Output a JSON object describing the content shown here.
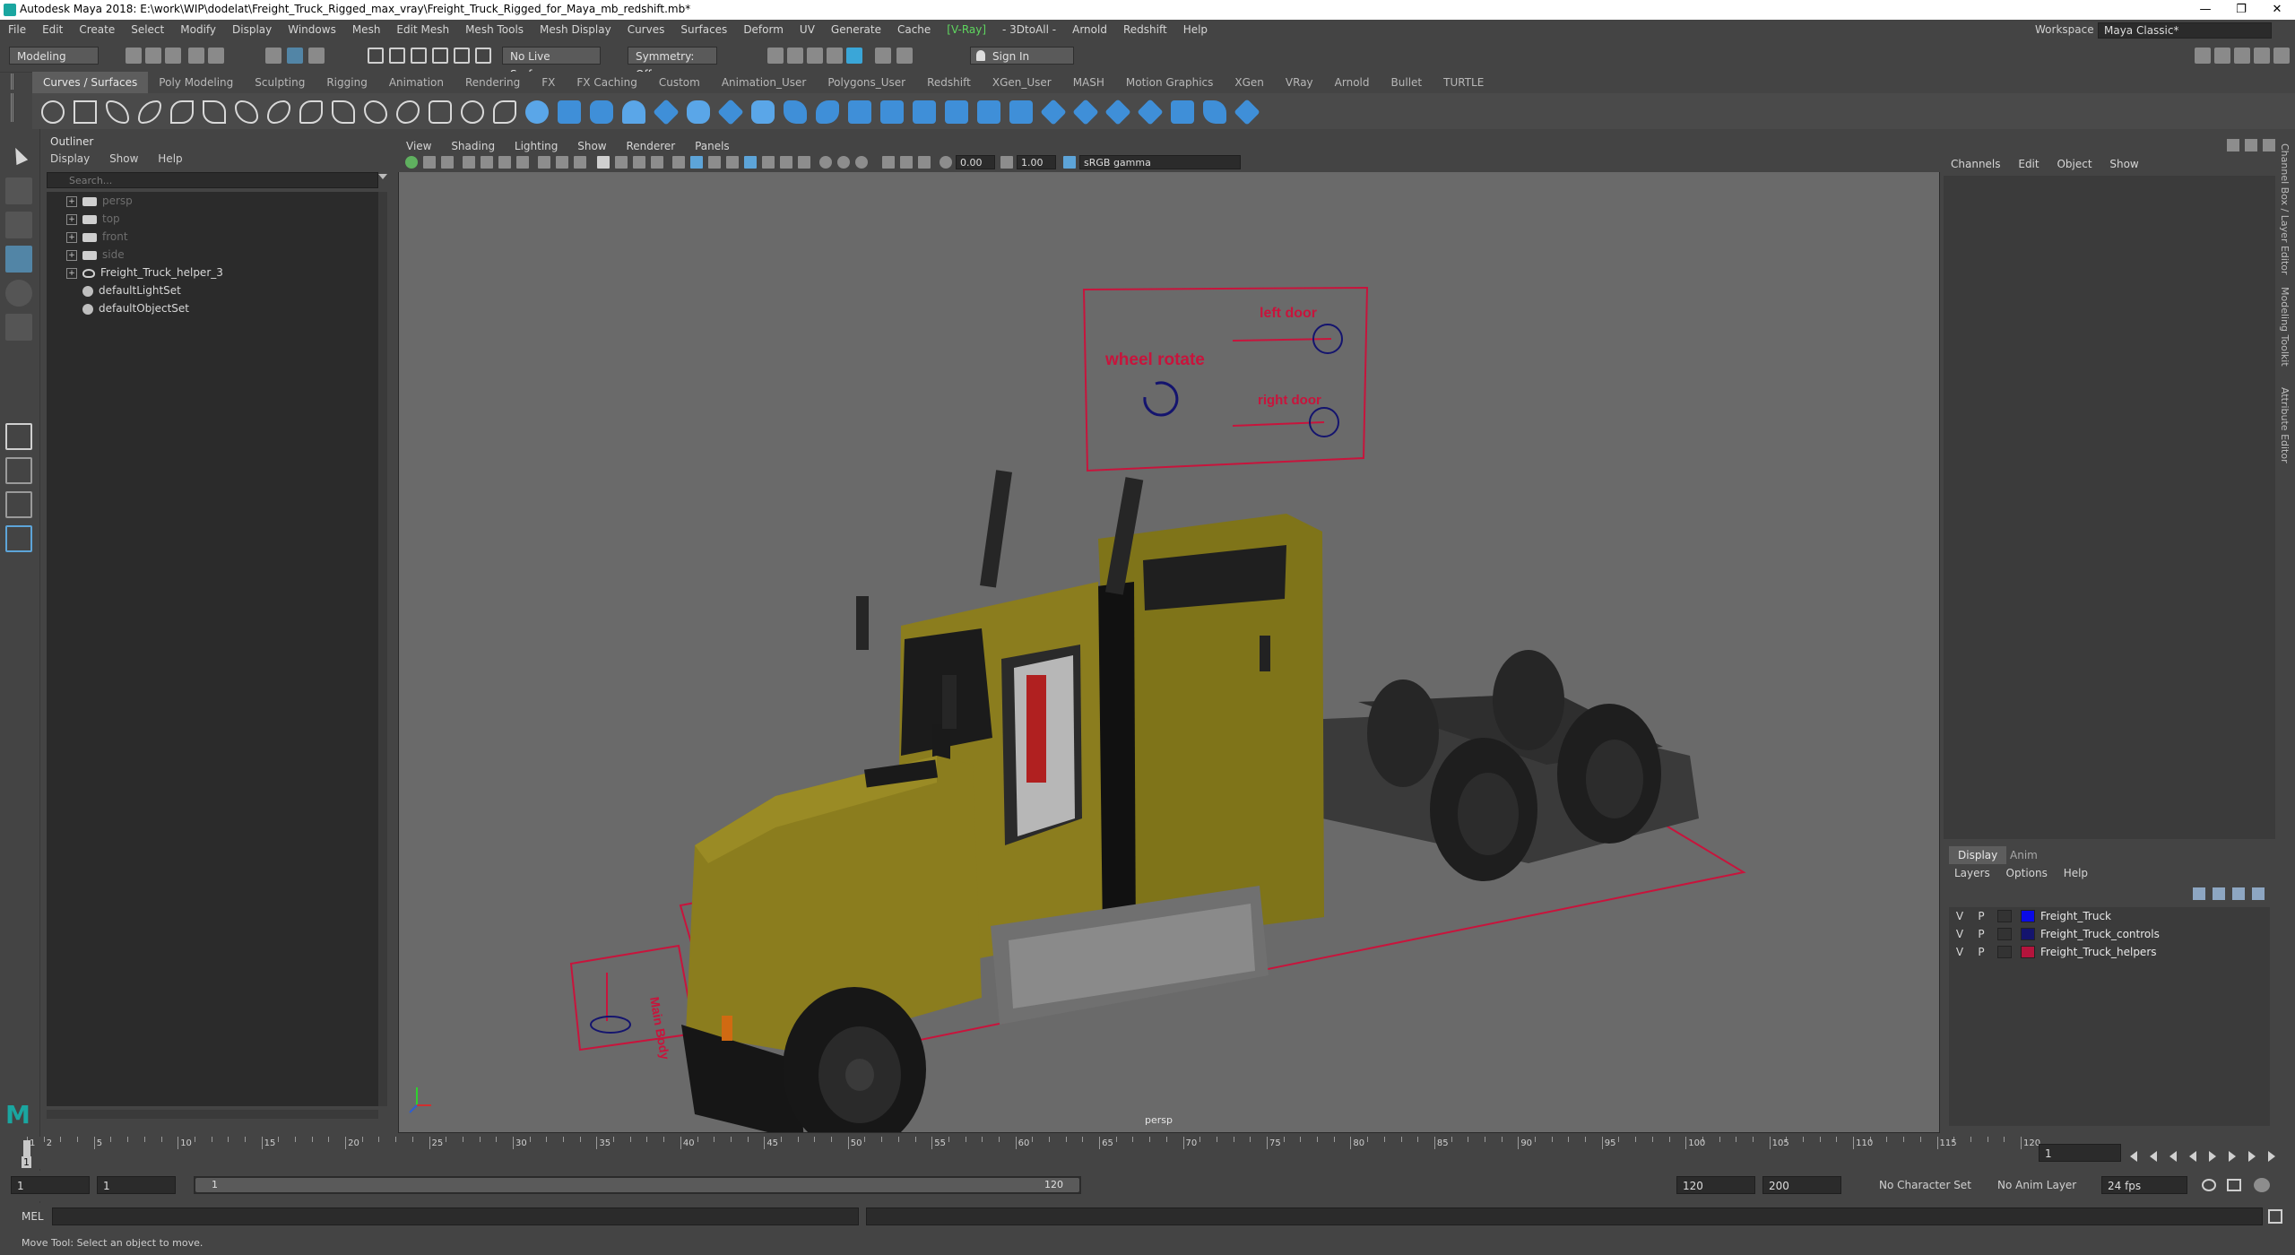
{
  "titlebar": {
    "title": "Autodesk Maya 2018: E:\\work\\WIP\\dodelat\\Freight_Truck_Rigged_max_vray\\Freight_Truck_Rigged_for_Maya_mb_redshift.mb*",
    "minimize": "—",
    "maximize": "❐",
    "close": "✕"
  },
  "menubar": {
    "items": [
      "File",
      "Edit",
      "Create",
      "Select",
      "Modify",
      "Display",
      "Windows",
      "Mesh",
      "Edit Mesh",
      "Mesh Tools",
      "Mesh Display",
      "Curves",
      "Surfaces",
      "Deform",
      "UV",
      "Generate",
      "Cache",
      "V-Ray",
      "3DtoAll",
      "Arnold",
      "Redshift",
      "Help"
    ],
    "vray_label": "[V-Ray]",
    "threedtoall_label": "- 3DtoAll -",
    "workspace_label": "Workspace :",
    "workspace_value": "Maya Classic*"
  },
  "statusline": {
    "mode": "Modeling",
    "live_surface": "No Live Surface",
    "symmetry": "Symmetry: Off",
    "sign_in": "Sign In"
  },
  "shelf": {
    "tabs": [
      "Curves / Surfaces",
      "Poly Modeling",
      "Sculpting",
      "Rigging",
      "Animation",
      "Rendering",
      "FX",
      "FX Caching",
      "Custom",
      "Animation_User",
      "Polygons_User",
      "Redshift",
      "XGen_User",
      "MASH",
      "Motion Graphics",
      "XGen",
      "VRay",
      "Arnold",
      "Bullet",
      "TURTLE"
    ],
    "active_tab": "Curves / Surfaces"
  },
  "outliner": {
    "title": "Outliner",
    "menu": [
      "Display",
      "Show",
      "Help"
    ],
    "search_placeholder": "Search...",
    "items": [
      {
        "label": "persp",
        "type": "camera",
        "dim": true
      },
      {
        "label": "top",
        "type": "camera",
        "dim": true
      },
      {
        "label": "front",
        "type": "camera",
        "dim": true
      },
      {
        "label": "side",
        "type": "camera",
        "dim": true
      },
      {
        "label": "Freight_Truck_helper_3",
        "type": "group",
        "dim": false
      },
      {
        "label": "defaultLightSet",
        "type": "set",
        "dim": false
      },
      {
        "label": "defaultObjectSet",
        "type": "set",
        "dim": false
      }
    ]
  },
  "viewport": {
    "menu": [
      "View",
      "Shading",
      "Lighting",
      "Show",
      "Renderer",
      "Panels"
    ],
    "exposure": "0.00",
    "gamma": "1.00",
    "color_space": "sRGB gamma",
    "camera_label": "persp",
    "controls": {
      "left_door": "left door",
      "right_door": "right door",
      "wheel_rotate": "wheel rotate",
      "helper_text": "Main Body"
    }
  },
  "channelbox": {
    "menu": [
      "Channels",
      "Edit",
      "Object",
      "Show"
    ]
  },
  "layers": {
    "tabs": [
      "Display",
      "Anim"
    ],
    "active_tab": "Display",
    "menu": [
      "Layers",
      "Options",
      "Help"
    ],
    "rows": [
      {
        "v": "V",
        "p": "P",
        "name": "Freight_Truck",
        "color": "#0a0ae6"
      },
      {
        "v": "V",
        "p": "P",
        "name": "Freight_Truck_controls",
        "color": "#14146e"
      },
      {
        "v": "V",
        "p": "P",
        "name": "Freight_Truck_helpers",
        "color": "#b4143c"
      }
    ]
  },
  "side_tabs": [
    "Channel Box / Layer Editor",
    "Modeling Toolkit",
    "Attribute Editor"
  ],
  "timeslider": {
    "labels": [
      "1",
      "2",
      "5",
      "10",
      "15",
      "20",
      "25",
      "30",
      "35",
      "40",
      "45",
      "50",
      "55",
      "60",
      "65",
      "70",
      "75",
      "80",
      "85",
      "90",
      "95",
      "100",
      "105",
      "110",
      "115",
      "120"
    ],
    "current_frame": "1",
    "current_frame_label": "1"
  },
  "range": {
    "start": "1",
    "start_inner": "1",
    "range_start": "1",
    "range_end": "120",
    "end_inner": "120",
    "end": "200",
    "character_set": "No Character Set",
    "anim_layer": "No Anim Layer",
    "fps": "24 fps"
  },
  "cmdline": {
    "label": "MEL"
  },
  "helpline": {
    "text": "Move Tool: Select an object to move."
  },
  "colors": {
    "truck_body": "#8b7d1e",
    "control_red": "#c8143c",
    "control_blue": "#14146e"
  }
}
